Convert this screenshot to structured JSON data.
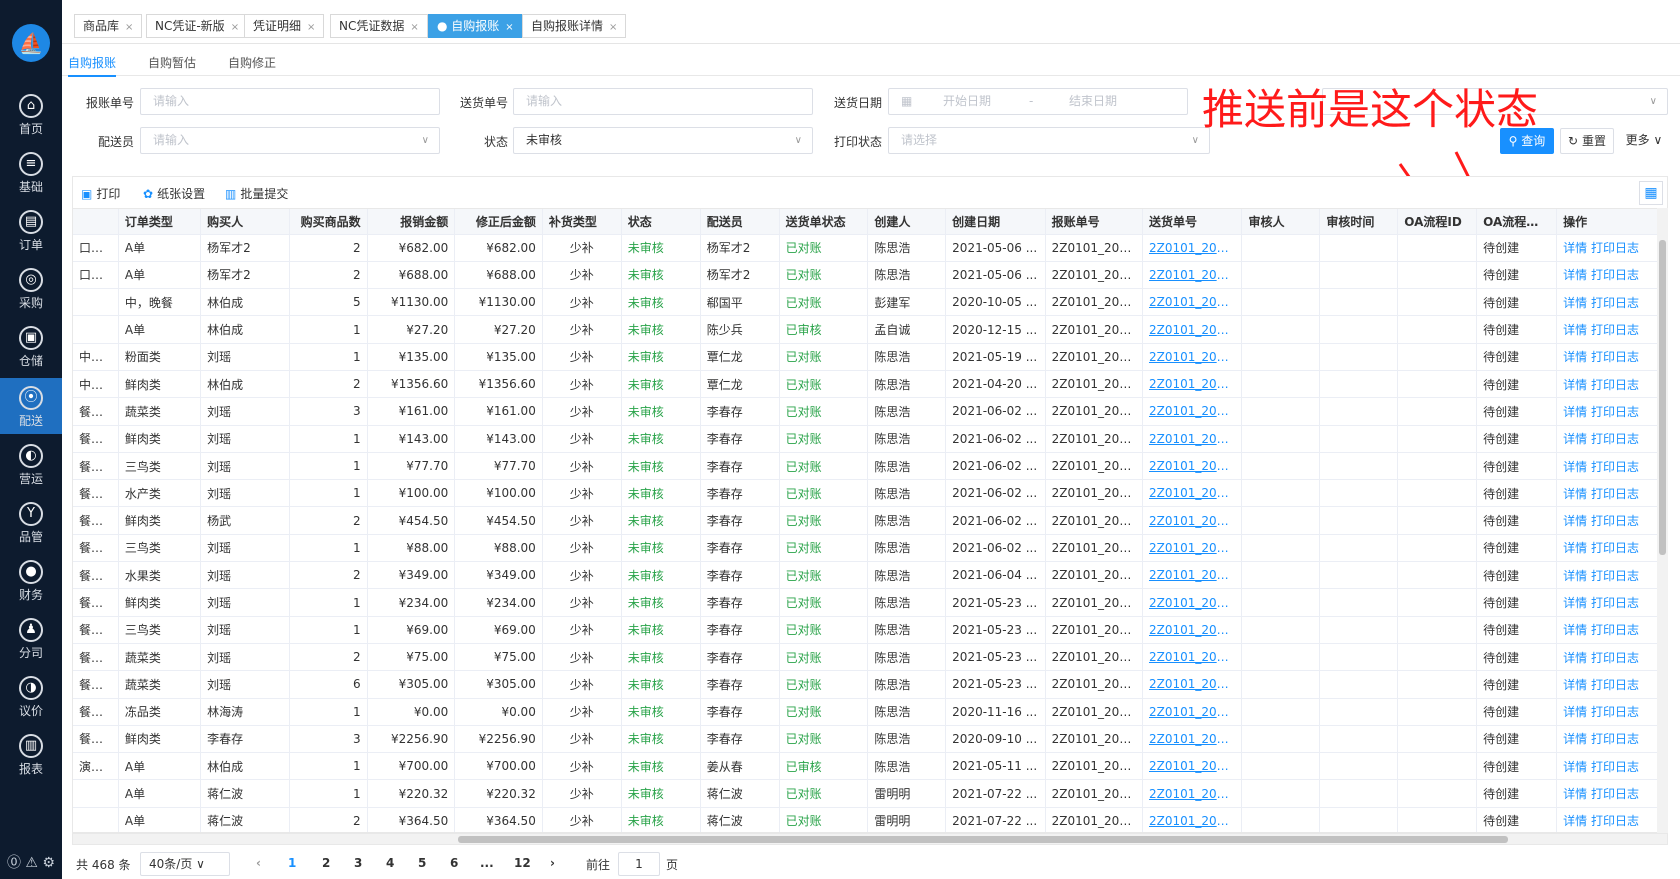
{
  "sidebar": {
    "logo": "⛵",
    "items": [
      {
        "label": "首页",
        "icon": "⌂"
      },
      {
        "label": "基础",
        "icon": "≡"
      },
      {
        "label": "订单",
        "icon": "▤"
      },
      {
        "label": "采购",
        "icon": "◎"
      },
      {
        "label": "仓储",
        "icon": "▣"
      },
      {
        "label": "配送",
        "icon": "⦿"
      },
      {
        "label": "营运",
        "icon": "◐"
      },
      {
        "label": "品管",
        "icon": "Y"
      },
      {
        "label": "财务",
        "icon": "●"
      },
      {
        "label": "分司",
        "icon": "♟"
      },
      {
        "label": "议价",
        "icon": "◑"
      },
      {
        "label": "报表",
        "icon": "▥"
      }
    ],
    "bottom_icons": "⓪ ⚠ ⚙"
  },
  "tabs": [
    {
      "label": "商品库"
    },
    {
      "label": "NC凭证-新版"
    },
    {
      "label": "凭证明细"
    },
    {
      "label": "NC凭证数据"
    },
    {
      "label": "● 自购报账"
    },
    {
      "label": "自购报账详情"
    }
  ],
  "subtabs": [
    "自购报账",
    "自购暂估",
    "自购修正"
  ],
  "filters": {
    "bill_no_label": "报账单号",
    "bill_no_placeholder": "请输入",
    "delivery_no_label": "送货单号",
    "delivery_no_placeholder": "请输入",
    "delivery_date_label": "送货日期",
    "start_date": "开始日期",
    "date_sep": "-",
    "end_date": "结束日期",
    "deliverer_label": "配送员",
    "deliverer_placeholder": "请输入",
    "status_label": "状态",
    "status_value": "未审核",
    "print_status_label": "打印状态",
    "print_status_placeholder": "请选择",
    "query": "查询",
    "reset": "重置",
    "more": "更多"
  },
  "annotation": "推送前是这个状态",
  "toolbar": {
    "print": "打印",
    "paper": "纸张设置",
    "batch": "批量提交"
  },
  "columns": [
    "",
    "订单类型",
    "购买人",
    "购买商品数",
    "报销金额",
    "修正后金额",
    "补货类型",
    "状态",
    "配送员",
    "送货单状态",
    "创建人",
    "创建日期",
    "报账单号",
    "送货单号",
    "审核人",
    "审核时间",
    "OA流程ID",
    "OA流程状态",
    "操作"
  ],
  "rows": [
    [
      "口派...",
      "A单",
      "杨军才2",
      "2",
      "¥682.00",
      "¥682.00",
      "少补",
      "未审核",
      "杨军才2",
      "已对账",
      "陈思浩",
      "2021-05-06 ...",
      "2Z0101_202...",
      "2Z0101_202...",
      "",
      "",
      "",
      "待创建"
    ],
    [
      "口派...",
      "A单",
      "杨军才2",
      "2",
      "¥688.00",
      "¥688.00",
      "少补",
      "未审核",
      "杨军才2",
      "已对账",
      "陈思浩",
      "2021-05-06 ...",
      "2Z0101_202...",
      "2Z0101_202...",
      "",
      "",
      "",
      "待创建"
    ],
    [
      "",
      "中，晚餐",
      "林伯成",
      "5",
      "¥1130.00",
      "¥1130.00",
      "少补",
      "未审核",
      "郗国平",
      "已对账",
      "彭建军",
      "2020-10-05 ...",
      "2Z0101_202...",
      "2Z0101_202...",
      "",
      "",
      "",
      "待创建"
    ],
    [
      "",
      "A单",
      "林伯成",
      "1",
      "¥27.20",
      "¥27.20",
      "少补",
      "未审核",
      "陈少兵",
      "已审核",
      "孟自诚",
      "2020-12-15 ...",
      "2Z0101_202...",
      "2Z0101_202...",
      "",
      "",
      "",
      "待创建"
    ],
    [
      "中心...",
      "粉面类",
      "刘瑶",
      "1",
      "¥135.00",
      "¥135.00",
      "少补",
      "未审核",
      "覃仁龙",
      "已对账",
      "陈思浩",
      "2021-05-19 ...",
      "2Z0101_202...",
      "2Z0101_202...",
      "",
      "",
      "",
      "待创建"
    ],
    [
      "中心...",
      "鲜肉类",
      "林伯成",
      "2",
      "¥1356.60",
      "¥1356.60",
      "少补",
      "未审核",
      "覃仁龙",
      "已对账",
      "陈思浩",
      "2021-04-20 ...",
      "2Z0101_202...",
      "2Z0101_202...",
      "",
      "",
      "",
      "待创建"
    ],
    [
      "餐厅...",
      "蔬菜类",
      "刘瑶",
      "3",
      "¥161.00",
      "¥161.00",
      "少补",
      "未审核",
      "李春存",
      "已对账",
      "陈思浩",
      "2021-06-02 ...",
      "2Z0101_202...",
      "2Z0101_202...",
      "",
      "",
      "",
      "待创建"
    ],
    [
      "餐厅...",
      "鲜肉类",
      "刘瑶",
      "1",
      "¥143.00",
      "¥143.00",
      "少补",
      "未审核",
      "李春存",
      "已对账",
      "陈思浩",
      "2021-06-02 ...",
      "2Z0101_202...",
      "2Z0101_202...",
      "",
      "",
      "",
      "待创建"
    ],
    [
      "餐厅...",
      "三鸟类",
      "刘瑶",
      "1",
      "¥77.70",
      "¥77.70",
      "少补",
      "未审核",
      "李春存",
      "已对账",
      "陈思浩",
      "2021-06-02 ...",
      "2Z0101_202...",
      "2Z0101_202...",
      "",
      "",
      "",
      "待创建"
    ],
    [
      "餐厅...",
      "水产类",
      "刘瑶",
      "1",
      "¥100.00",
      "¥100.00",
      "少补",
      "未审核",
      "李春存",
      "已对账",
      "陈思浩",
      "2021-06-02 ...",
      "2Z0101_202...",
      "2Z0101_202...",
      "",
      "",
      "",
      "待创建"
    ],
    [
      "餐厅...",
      "鲜肉类",
      "杨武",
      "2",
      "¥454.50",
      "¥454.50",
      "少补",
      "未审核",
      "李春存",
      "已对账",
      "陈思浩",
      "2021-06-02 ...",
      "2Z0101_202...",
      "2Z0101_202...",
      "",
      "",
      "",
      "待创建"
    ],
    [
      "餐厅...",
      "三鸟类",
      "刘瑶",
      "1",
      "¥88.00",
      "¥88.00",
      "少补",
      "未审核",
      "李春存",
      "已对账",
      "陈思浩",
      "2021-06-02 ...",
      "2Z0101_202...",
      "2Z0101_202...",
      "",
      "",
      "",
      "待创建"
    ],
    [
      "餐厅...",
      "水果类",
      "刘瑶",
      "2",
      "¥349.00",
      "¥349.00",
      "少补",
      "未审核",
      "李春存",
      "已对账",
      "陈思浩",
      "2021-06-04 ...",
      "2Z0101_202...",
      "2Z0101_202...",
      "",
      "",
      "",
      "待创建"
    ],
    [
      "餐厅...",
      "鲜肉类",
      "刘瑶",
      "1",
      "¥234.00",
      "¥234.00",
      "少补",
      "未审核",
      "李春存",
      "已对账",
      "陈思浩",
      "2021-05-23 ...",
      "2Z0101_202...",
      "2Z0101_202...",
      "",
      "",
      "",
      "待创建"
    ],
    [
      "餐厅...",
      "三鸟类",
      "刘瑶",
      "1",
      "¥69.00",
      "¥69.00",
      "少补",
      "未审核",
      "李春存",
      "已对账",
      "陈思浩",
      "2021-05-23 ...",
      "2Z0101_202...",
      "2Z0101_202...",
      "",
      "",
      "",
      "待创建"
    ],
    [
      "餐厅...",
      "蔬菜类",
      "刘瑶",
      "2",
      "¥75.00",
      "¥75.00",
      "少补",
      "未审核",
      "李春存",
      "已对账",
      "陈思浩",
      "2021-05-23 ...",
      "2Z0101_202...",
      "2Z0101_202...",
      "",
      "",
      "",
      "待创建"
    ],
    [
      "餐厅...",
      "蔬菜类",
      "刘瑶",
      "6",
      "¥305.00",
      "¥305.00",
      "少补",
      "未审核",
      "李春存",
      "已对账",
      "陈思浩",
      "2021-05-23 ...",
      "2Z0101_202...",
      "2Z0101_202...",
      "",
      "",
      "",
      "待创建"
    ],
    [
      "餐厅...",
      "冻品类",
      "林海涛",
      "1",
      "¥0.00",
      "¥0.00",
      "少补",
      "未审核",
      "李春存",
      "已对账",
      "陈思浩",
      "2020-11-16 ...",
      "2Z0101_202...",
      "2Z0101_202...",
      "",
      "",
      "",
      "待创建"
    ],
    [
      "餐厅...",
      "鲜肉类",
      "李春存",
      "3",
      "¥2256.90",
      "¥2256.90",
      "少补",
      "未审核",
      "李春存",
      "已对账",
      "陈思浩",
      "2020-09-10 ...",
      "2Z0101_202...",
      "2Z0101_202...",
      "",
      "",
      "",
      "待创建"
    ],
    [
      "演实...",
      "A单",
      "林伯成",
      "1",
      "¥700.00",
      "¥700.00",
      "少补",
      "未审核",
      "姜从春",
      "已审核",
      "陈思浩",
      "2021-05-11 ...",
      "2Z0101_202...",
      "2Z0101_202...",
      "",
      "",
      "",
      "待创建"
    ],
    [
      "",
      "A单",
      "蒋仁波",
      "1",
      "¥220.32",
      "¥220.32",
      "少补",
      "未审核",
      "蒋仁波",
      "已对账",
      "雷明明",
      "2021-07-22 ...",
      "2Z0101_202...",
      "2Z0101_202...",
      "",
      "",
      "",
      "待创建"
    ],
    [
      "",
      "A单",
      "蒋仁波",
      "2",
      "¥364.50",
      "¥364.50",
      "少补",
      "未审核",
      "蒋仁波",
      "已对账",
      "雷明明",
      "2021-07-22 ...",
      "2Z0101_202...",
      "2Z0101_202...",
      "",
      "",
      "",
      "待创建"
    ]
  ],
  "row_actions": {
    "detail": "详情",
    "print_log": "打印日志"
  },
  "pager": {
    "total": "共 468 条",
    "page_size": "40条/页",
    "pages": [
      "1",
      "2",
      "3",
      "4",
      "5",
      "6",
      "...",
      "12"
    ],
    "goto": "前往",
    "goto_value": "1",
    "page_unit": "页",
    "prev": "‹",
    "next": "›"
  },
  "colors": {
    "accent": "#1890ff",
    "sidebar": "#0d1b2e",
    "active_nav": "#1f6fc0",
    "status_green": "#29a349",
    "annotation": "#ff1a1a"
  }
}
